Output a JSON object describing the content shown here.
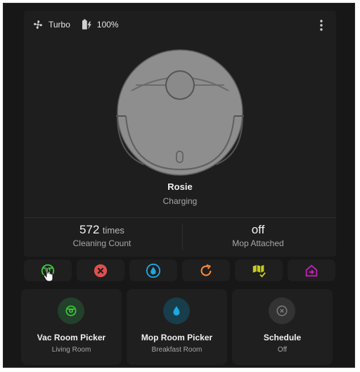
{
  "status": {
    "fan_icon": "fan-icon",
    "fan_speed": "Turbo",
    "battery_icon": "battery-charging-icon",
    "battery": "100%"
  },
  "vacuum": {
    "name": "Rosie",
    "state": "Charging"
  },
  "stats": [
    {
      "value": "572",
      "unit": "times",
      "label": "Cleaning Count"
    },
    {
      "value": "off",
      "unit": "",
      "label": "Mop Attached"
    }
  ],
  "actions": [
    {
      "name": "vacuum-clean-icon",
      "color": "#3ec93e"
    },
    {
      "name": "stop-icon",
      "color": "#e05050"
    },
    {
      "name": "water-drop-icon",
      "color": "#1ea8e0"
    },
    {
      "name": "refresh-icon",
      "color": "#ff8c3a"
    },
    {
      "name": "map-check-icon",
      "color": "#c6cc1e"
    },
    {
      "name": "home-return-icon",
      "color": "#c41fb7"
    }
  ],
  "tiles": [
    {
      "title": "Vac Room Picker",
      "subtitle": "Living Room",
      "icon": "vacuum-clean-icon",
      "color": "#3ec93e"
    },
    {
      "title": "Mop Room Picker",
      "subtitle": "Breakfast Room",
      "icon": "water-drop-icon",
      "color": "#1ea8e0"
    },
    {
      "title": "Schedule",
      "subtitle": "Off",
      "icon": "cancel-circle-icon",
      "color": "#7d7d7d"
    }
  ]
}
